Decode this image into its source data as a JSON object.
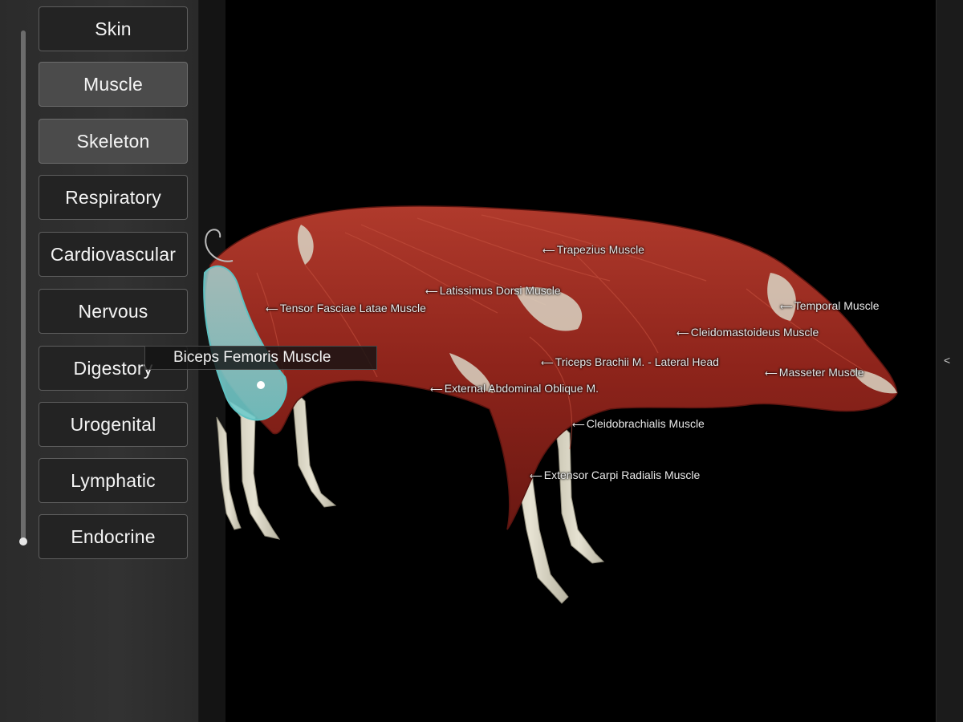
{
  "sidebar": {
    "systems": [
      {
        "label": "Skin",
        "active": false
      },
      {
        "label": "Muscle",
        "active": true
      },
      {
        "label": "Skeleton",
        "active": true
      },
      {
        "label": "Respiratory",
        "active": false
      },
      {
        "label": "Cardiovascular",
        "active": false
      },
      {
        "label": "Nervous",
        "active": false
      },
      {
        "label": "Digestory",
        "active": false
      },
      {
        "label": "Urogenital",
        "active": false
      },
      {
        "label": "Lymphatic",
        "active": false
      },
      {
        "label": "Endocrine",
        "active": false
      }
    ]
  },
  "selection": {
    "label": "Biceps Femoris Muscle",
    "highlight_color": "#7fd6d6"
  },
  "muscle_labels": [
    "Trapezius Muscle",
    "Latissimus Dorsi Muscle",
    "Tensor Fasciae Latae Muscle",
    "Temporal Muscle",
    "Cleidomastoideus Muscle",
    "Triceps Brachii M. - Lateral Head",
    "Masseter Muscle",
    "External Abdominal Oblique M.",
    "Cleidobrachialis Muscle",
    "Extensor Carpi Radialis Muscle"
  ],
  "right_rail": {
    "icon": "chevron-left-icon",
    "glyph": "<"
  },
  "colors": {
    "muscle": "#9b2a20",
    "bone": "#d8d4c2",
    "background": "#000000"
  }
}
